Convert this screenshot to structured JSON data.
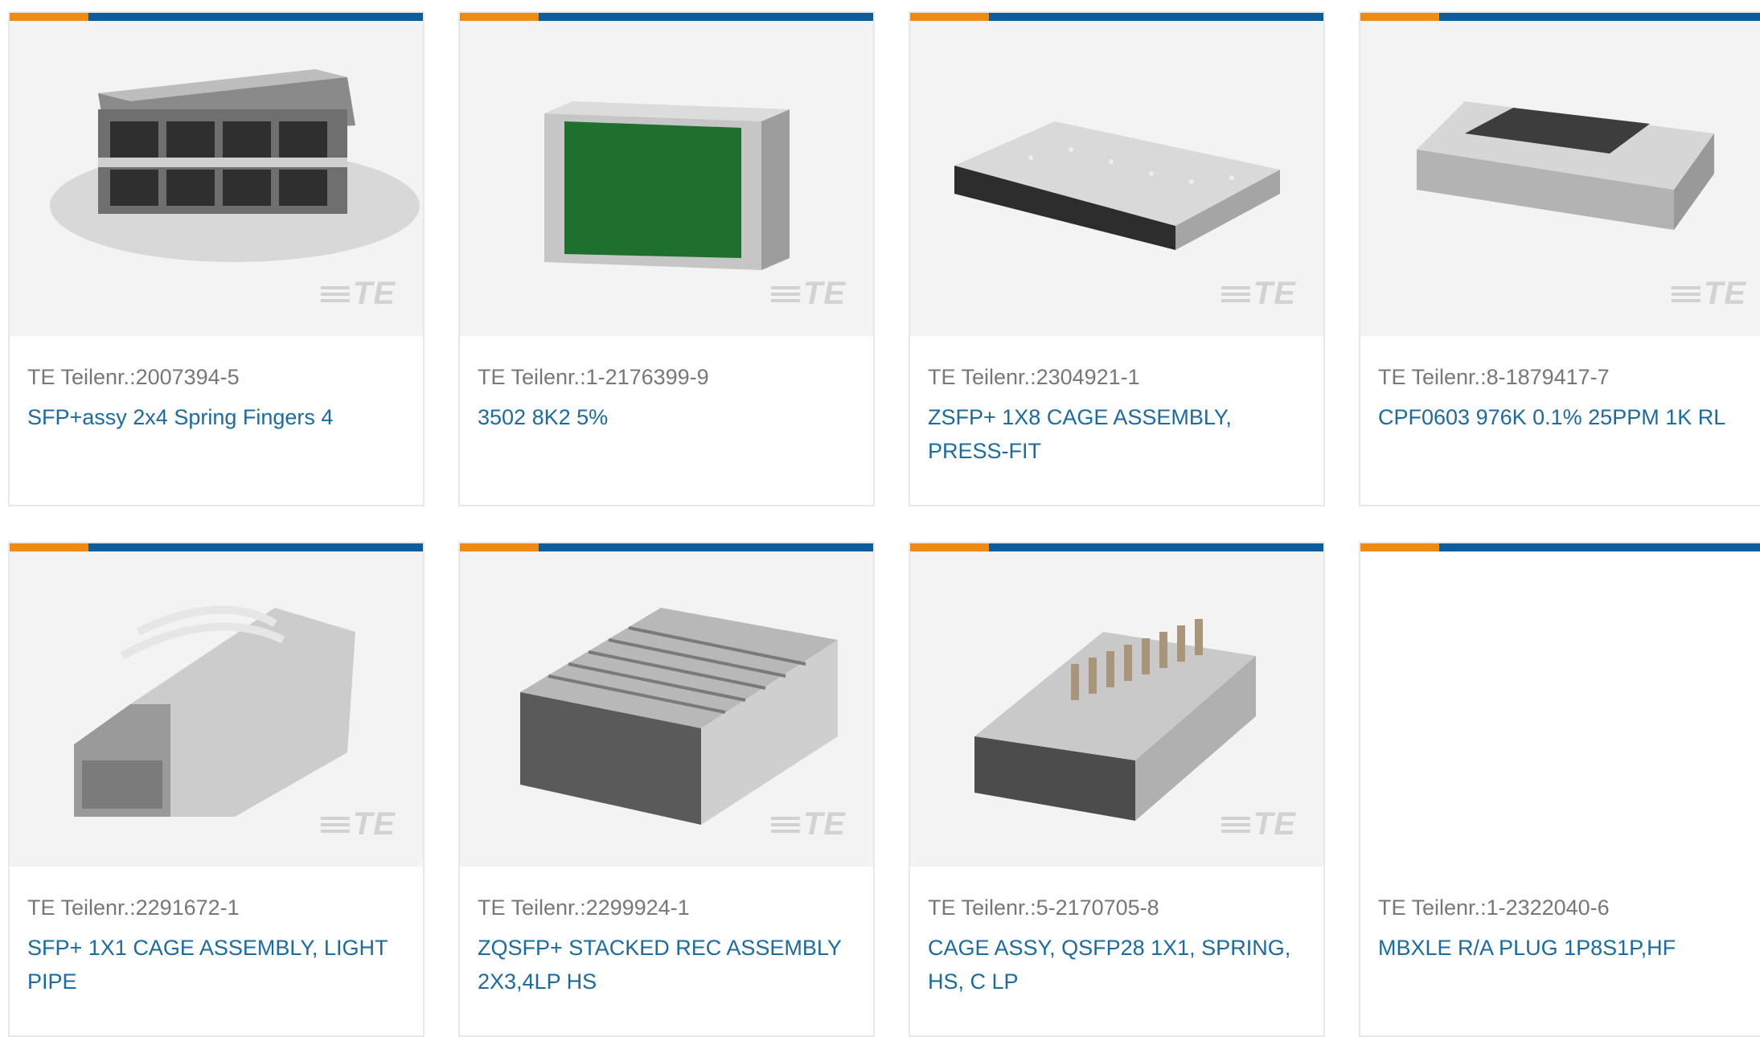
{
  "products": [
    {
      "part_label": "TE Teilenr.:2007394-5",
      "title": "SFP+assy 2x4 Spring Fingers 4",
      "image": "sfp-cage-2x4-image",
      "logo": "TE"
    },
    {
      "part_label": "TE Teilenr.:1-2176399-9",
      "title": "3502 8K2 5%",
      "image": "resistor-green-image",
      "logo": "TE"
    },
    {
      "part_label": "TE Teilenr.:2304921-1",
      "title": "ZSFP+ 1X8 CAGE ASSEMBLY, PRESS-FIT",
      "image": "zsfp-cage-1x8-image",
      "logo": "TE"
    },
    {
      "part_label": "TE Teilenr.:8-1879417-7",
      "title": "CPF0603 976K 0.1% 25PPM 1K RL",
      "image": "chip-resistor-image",
      "logo": "TE"
    },
    {
      "part_label": "TE Teilenr.:2291672-1",
      "title": "SFP+ 1X1 CAGE ASSEMBLY, LIGHT PIPE",
      "image": "sfp-lightpipe-image",
      "logo": "TE"
    },
    {
      "part_label": "TE Teilenr.:2299924-1",
      "title": "ZQSFP+ STACKED REC ASSEMBLY 2X3,4LP HS",
      "image": "zqsfp-stacked-image",
      "logo": "TE"
    },
    {
      "part_label": "TE Teilenr.:5-2170705-8",
      "title": "CAGE ASSY, QSFP28 1X1, SPRING, HS, C LP",
      "image": "qsfp28-cage-image",
      "logo": "TE"
    },
    {
      "part_label": "TE Teilenr.:1-2322040-6",
      "title": "MBXLE R/A PLUG 1P8S1P,HF",
      "image": "",
      "logo": ""
    }
  ],
  "colors": {
    "accent_orange": "#ef8b10",
    "accent_blue": "#0e5c99",
    "link": "#1b6aa0",
    "muted": "#777777"
  }
}
